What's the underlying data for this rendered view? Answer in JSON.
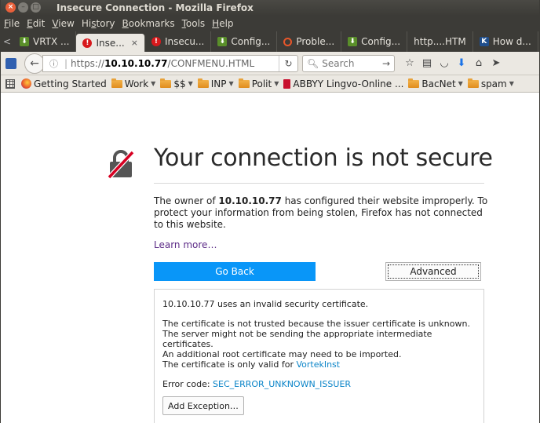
{
  "window": {
    "title": "Insecure Connection - Mozilla Firefox",
    "buttons": {
      "close": "×",
      "minimize": "–",
      "maximize": "□"
    }
  },
  "menubar": [
    {
      "pre": "",
      "u": "F",
      "post": "ile"
    },
    {
      "pre": "",
      "u": "E",
      "post": "dit"
    },
    {
      "pre": "",
      "u": "V",
      "post": "iew"
    },
    {
      "pre": "Hi",
      "u": "s",
      "post": "tory"
    },
    {
      "pre": "",
      "u": "B",
      "post": "ookmarks"
    },
    {
      "pre": "",
      "u": "T",
      "post": "ools"
    },
    {
      "pre": "",
      "u": "H",
      "post": "elp"
    }
  ],
  "tabs": [
    {
      "label": "VRTX ...",
      "icon": "green-download-icon",
      "active": false
    },
    {
      "label": "Inse...",
      "icon": "warning-icon",
      "active": true,
      "close": "×"
    },
    {
      "label": "Insecu...",
      "icon": "warning-icon",
      "active": false
    },
    {
      "label": "Config...",
      "icon": "green-download-icon",
      "active": false
    },
    {
      "label": "Proble...",
      "icon": "ring-icon",
      "active": false
    },
    {
      "label": "Config...",
      "icon": "green-download-icon",
      "active": false
    },
    {
      "label": "http....HTM",
      "icon": "",
      "active": false
    },
    {
      "label": "How d...",
      "icon": "k-icon",
      "active": false
    }
  ],
  "tab_scroll": "<",
  "navbar": {
    "url_proto": "https://",
    "url_host": "10.10.10.77",
    "url_path": "/CONFMENU.HTML",
    "search_placeholder": "Search"
  },
  "bookmarks": [
    {
      "label": "Getting Started",
      "type": "firefox",
      "dropdown": false
    },
    {
      "label": "Work",
      "type": "folder",
      "dropdown": true
    },
    {
      "label": "$$",
      "type": "folder",
      "dropdown": true
    },
    {
      "label": "INP",
      "type": "folder",
      "dropdown": true
    },
    {
      "label": "Polit",
      "type": "folder",
      "dropdown": true
    },
    {
      "label": "ABBYY Lingvo-Online ...",
      "type": "abbyy",
      "dropdown": false
    },
    {
      "label": "BacNet",
      "type": "folder",
      "dropdown": true
    },
    {
      "label": "spam",
      "type": "folder",
      "dropdown": true
    }
  ],
  "error": {
    "title": "Your connection is not secure",
    "desc_pre": "The owner of ",
    "desc_host": "10.10.10.77",
    "desc_post": " has configured their website improperly. To protect your information from being stolen, Firefox has not connected to this website.",
    "learn_more": "Learn more…",
    "go_back": "Go Back",
    "advanced": "Advanced"
  },
  "advanced_panel": {
    "line1": "10.10.10.77 uses an invalid security certificate.",
    "line2": "The certificate is not trusted because the issuer certificate is unknown.",
    "line3": "The server might not be sending the appropriate intermediate certificates.",
    "line4": "An additional root certificate may need to be imported.",
    "line5_pre": "The certificate is only valid for ",
    "line5_link": "VortekInst",
    "error_code_label": "Error code: ",
    "error_code": "SEC_ERROR_UNKNOWN_ISSUER",
    "add_exception": "Add Exception…"
  },
  "colors": {
    "primary_button": "#0996f8",
    "link": "#0a84c8",
    "visited_link": "#5b2a86",
    "titlebar": "#3c3b37"
  }
}
